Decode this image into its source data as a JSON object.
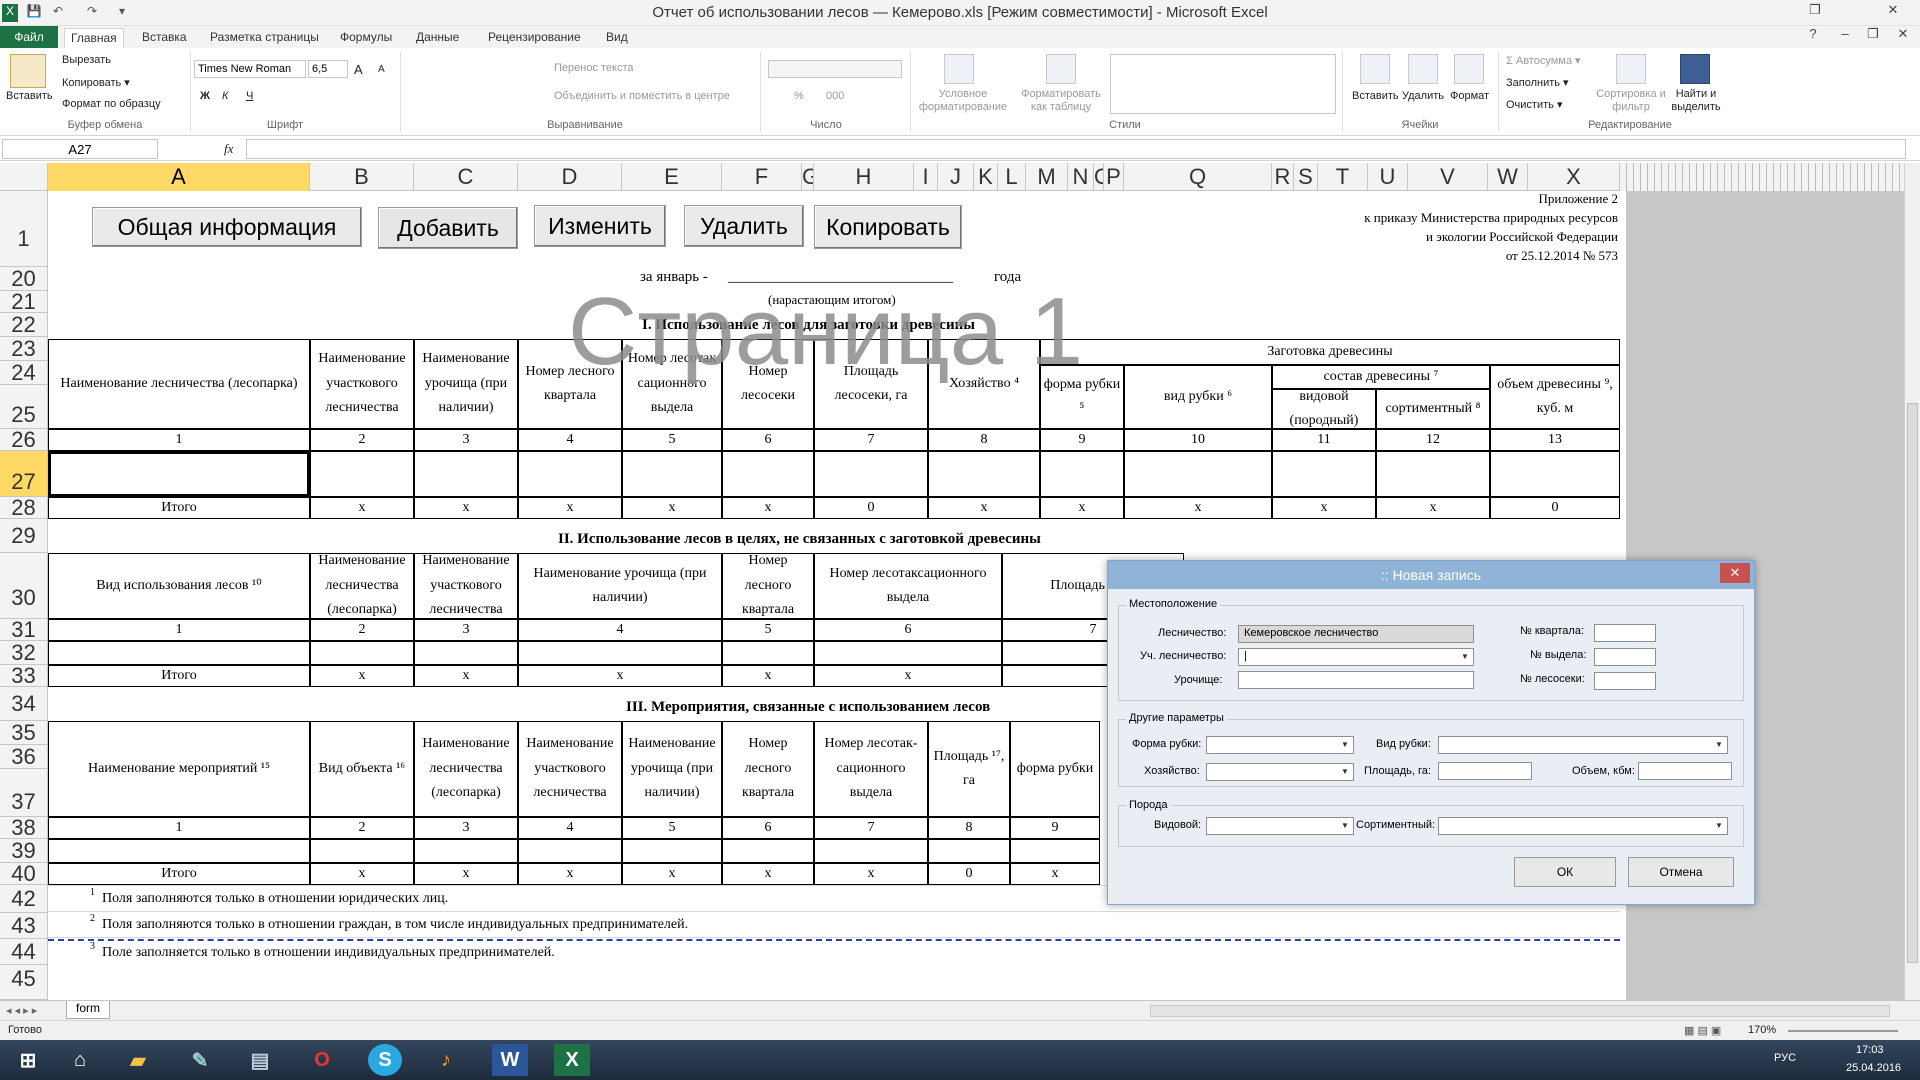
{
  "window": {
    "title": "Отчет об использовании лесов — Кемерово.xls  [Режим совместимости]  -  Microsoft Excel",
    "quick_access": [
      "X",
      "💾",
      "↶",
      "↷",
      "▾"
    ],
    "controls": {
      "help": "?",
      "minimize": "–",
      "restore": "❐",
      "close": "✕",
      "restore_top": "❐",
      "close_top": "✕"
    }
  },
  "ribbon": {
    "tabs": [
      "Файл",
      "Главная",
      "Вставка",
      "Разметка страницы",
      "Формулы",
      "Данные",
      "Рецензирование",
      "Вид"
    ],
    "active_tab": "Главная",
    "clipboard": {
      "paste": "Вставить",
      "cut": "Вырезать",
      "copy": "Копировать ▾",
      "format_painter": "Формат по образцу",
      "group": "Буфер обмена"
    },
    "font": {
      "name": "Times New Roman",
      "size": "6,5",
      "bold": "Ж",
      "italic": "К",
      "underline": "Ч",
      "grow": "A",
      "shrink": "A",
      "group": "Шрифт"
    },
    "alignment": {
      "wrap": "Перенос текста",
      "merge": "Объединить и поместить в центре",
      "group": "Выравнивание"
    },
    "number": {
      "format": "",
      "percent": "%",
      "thousands": "000",
      "group": "Число"
    },
    "styles": {
      "conditional": "Условное форматирование",
      "table": "Форматировать как таблицу",
      "group": "Стили"
    },
    "cells": {
      "insert": "Вставить",
      "delete": "Удалить",
      "format": "Формат",
      "group": "Ячейки"
    },
    "editing": {
      "autosum": "Σ Автосумма ▾",
      "fill": "Заполнить ▾",
      "clear": "Очистить ▾",
      "sort": "Сортировка и фильтр",
      "find": "Найти и выделить",
      "group": "Редактирование"
    }
  },
  "formula_bar": {
    "name_box": "A27",
    "fx": "fx",
    "value": ""
  },
  "columns": [
    "A",
    "B",
    "C",
    "D",
    "E",
    "F",
    "G",
    "H",
    "I",
    "J",
    "K",
    "L",
    "M",
    "N",
    "O",
    "P",
    "Q",
    "R",
    "S",
    "T",
    "U",
    "V",
    "W",
    "X"
  ],
  "rows": [
    "1",
    "20",
    "21",
    "22",
    "23",
    "24",
    "25",
    "26",
    "27",
    "28",
    "29",
    "30",
    "31",
    "32",
    "33",
    "34",
    "35",
    "36",
    "37",
    "38",
    "39",
    "40",
    "42",
    "43",
    "44",
    "45"
  ],
  "selected_cell": "A27",
  "sheet_buttons": [
    "Общая информация",
    "Добавить",
    "Изменить",
    "Удалить",
    "Копировать"
  ],
  "appendix": [
    "Приложение 2",
    "к приказу Министерства природных ресурсов",
    "и экологии Российской Федерации",
    "от 25.12.2014 № 573"
  ],
  "period": {
    "label": "за январь -",
    "blank": "______________________________",
    "year": "года",
    "cumulative": "(нарастающим итогом)"
  },
  "watermark": "Страница 1",
  "section1": {
    "title": "I. Использование лесов для заготовки древесины",
    "headers": {
      "a": "Наименование лесничества (лесопарка)",
      "b": "Наименование участкового лесничества",
      "c": "Наименование урочища (при наличии)",
      "d": "Номер лесного квартала",
      "e": "Номер лесотак сационного выдела",
      "f": "Номер лесосеки",
      "g": "Площадь лесосеки, га",
      "h": "Хозяйство ⁴",
      "timber": "Заготовка древесины",
      "form": "форма рубки ⁵",
      "type": "вид рубки ⁶",
      "composition": "состав древесины ⁷",
      "species": "видовой (породный)",
      "assortment": "сортиментный ⁸",
      "volume": "объем древесины ⁹, куб. м"
    },
    "numbers": [
      "1",
      "2",
      "3",
      "4",
      "5",
      "6",
      "7",
      "8",
      "9",
      "10",
      "11",
      "12",
      "13"
    ],
    "total": [
      "Итого",
      "x",
      "x",
      "x",
      "x",
      "x",
      "0",
      "x",
      "x",
      "x",
      "x",
      "x",
      "0"
    ]
  },
  "section2": {
    "title": "II. Использование лесов в целях, не связанных с заготовкой древесины",
    "headers": [
      "Вид использования лесов ¹⁰",
      "Наименование лесничества (лесопарка)",
      "Наименование участкового лесничества",
      "Наименование урочища (при наличии)",
      "Номер лесного квартала",
      "Номер лесотаксационного выдела",
      "Площадь ¹¹, га"
    ],
    "numbers": [
      "1",
      "2",
      "3",
      "4",
      "5",
      "6",
      "7"
    ],
    "total": [
      "Итого",
      "x",
      "x",
      "x",
      "x",
      "x",
      ""
    ]
  },
  "section3": {
    "title": "III. Мероприятия, связанные с использованием лесов",
    "headers": [
      "Наименование мероприятий ¹⁵",
      "Вид объекта ¹⁶",
      "Наименование лесничества (лесопарка)",
      "Наименование участкового лесничества",
      "Наименование урочища (при наличии)",
      "Номер лесного квартала",
      "Номер лесотак-сационного выдела",
      "Площадь ¹⁷, га",
      "форма рубки"
    ],
    "numbers": [
      "1",
      "2",
      "3",
      "4",
      "5",
      "6",
      "7",
      "8",
      "9"
    ],
    "total": [
      "Итого",
      "x",
      "x",
      "x",
      "x",
      "x",
      "x",
      "0",
      "x"
    ]
  },
  "footnotes": [
    {
      "n": "1",
      "text": "Поля заполняются только в отношении юридических лиц."
    },
    {
      "n": "2",
      "text": "Поля заполняются только в отношении граждан, в том числе индивидуальных предпринимателей."
    },
    {
      "n": "3",
      "text": "Поле заполняется только в отношении индивидуальных предпринимателей."
    }
  ],
  "dialog": {
    "title": ":: Новая запись",
    "location_group": "Местоположение",
    "forestry_label": "Лесничество:",
    "forestry_value": "Кемеровское лесничество",
    "district_label": "Уч. лесничество:",
    "district_value": "|",
    "tract_label": "Урочище:",
    "quarter_label": "№ квартала:",
    "allot_label": "№ выдела:",
    "plot_label": "№ лесосеки:",
    "other_group": "Другие параметры",
    "form_label": "Форма рубки:",
    "type_label": "Вид рубки:",
    "farm_label": "Хозяйство:",
    "area_label": "Площадь, га:",
    "volume_label": "Объем, кбм:",
    "breed_group": "Порода",
    "species_label": "Видовой:",
    "assort_label": "Сортиментный:",
    "ok": "ОК",
    "cancel": "Отмена"
  },
  "sheet_tab": "form",
  "status": {
    "ready": "Готово",
    "zoom": "170%"
  },
  "taskbar": {
    "lang": "РУС",
    "time": "17:03",
    "date": "25.04.2016"
  },
  "colors": {
    "excel_green": "#1e7145",
    "selection": "#ffd966",
    "dialog_title": "#8fb4d7",
    "close_red": "#c75050",
    "watermark": "#8c8c8c"
  }
}
